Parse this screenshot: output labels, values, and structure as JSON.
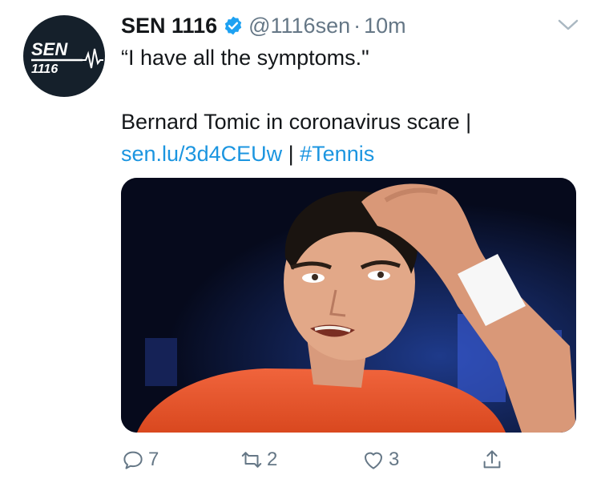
{
  "tweet": {
    "display_name": "SEN 1116",
    "handle": "@1116sen",
    "separator": "·",
    "time": "10m",
    "avatar_logo": {
      "brand_text": "SEN",
      "number_text": "1116"
    },
    "text": {
      "line1": "“I have all the symptoms.\"",
      "line2": "Bernard Tomic in coronavirus scare |",
      "link": "sen.lu/3d4CEUw",
      "pipe": " | ",
      "hashtag": "#Tennis"
    },
    "media": {
      "description": "photo"
    },
    "actions": {
      "reply": {
        "icon": "reply-icon",
        "count": "7"
      },
      "retweet": {
        "icon": "retweet-icon",
        "count": "2"
      },
      "like": {
        "icon": "heart-icon",
        "count": "3"
      },
      "share": {
        "icon": "share-icon"
      }
    }
  },
  "colors": {
    "text": "#14171a",
    "secondary": "#657786",
    "link": "#1b95e0",
    "verified": "#1da1f2",
    "avatar_bg": "#15202b"
  }
}
